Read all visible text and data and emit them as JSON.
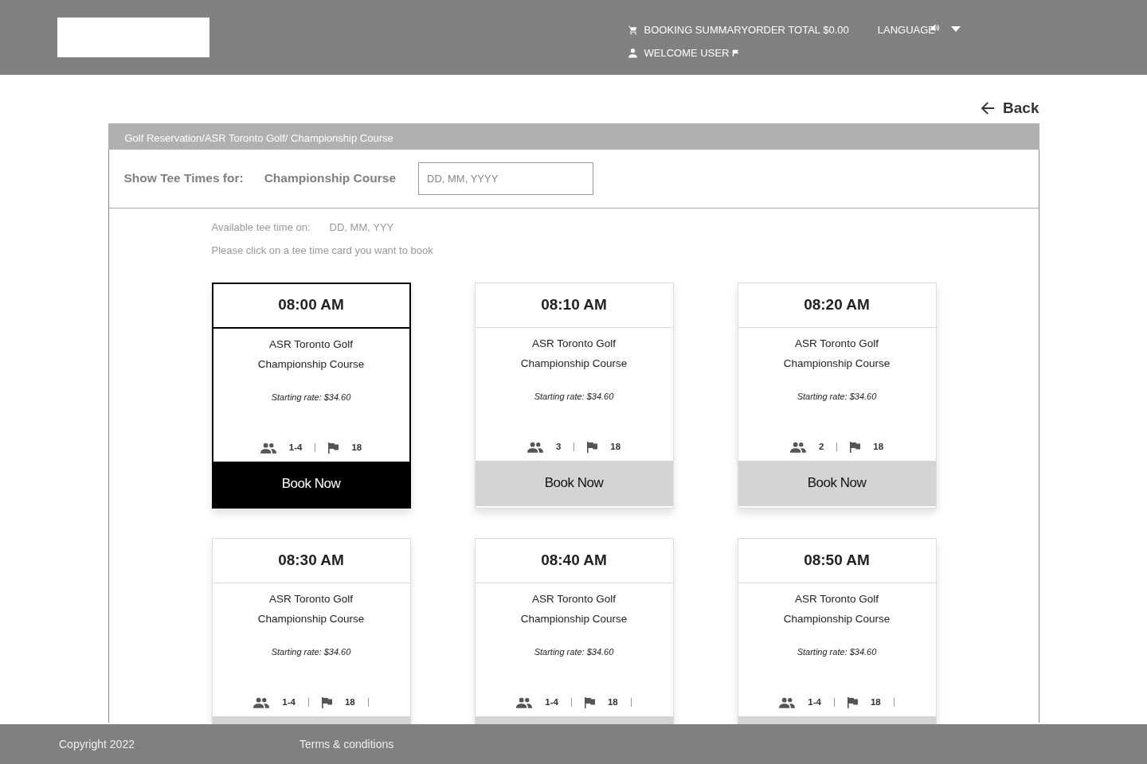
{
  "header": {
    "booking_summary": "BOOKING SUMMARYORDER TOTAL $0.00",
    "language": "LANGUAGE",
    "welcome": "WELCOME USER"
  },
  "back": "Back",
  "breadcrumb": "Golf Reservation/ASR Toronto Golf/ Championship Course",
  "filter": {
    "label": "Show Tee Times for:",
    "course": "Championship Course",
    "date_placeholder": "DD, MM, YYYY"
  },
  "available": {
    "label": "Available tee time on:",
    "date": "DD, MM, YYY"
  },
  "instruction": "Please click on a tee time card you want to book",
  "cards": [
    {
      "time": "08:00 AM",
      "club": "ASR Toronto Golf",
      "course": "Championship Course",
      "rate": "Starting rate: $34.60",
      "players": "1-4",
      "holes": "18",
      "selected": true,
      "trailing_divider": false,
      "button": "Book Now"
    },
    {
      "time": "08:10 AM",
      "club": "ASR Toronto Golf",
      "course": "Championship Course",
      "rate": "Starting rate: $34.60",
      "players": "3",
      "holes": "18",
      "selected": false,
      "trailing_divider": false,
      "button": "Book Now"
    },
    {
      "time": "08:20 AM",
      "club": "ASR Toronto Golf",
      "course": "Championship Course",
      "rate": "Starting rate: $34.60",
      "players": "2",
      "holes": "18",
      "selected": false,
      "trailing_divider": false,
      "button": "Book Now"
    },
    {
      "time": "08:30 AM",
      "club": "ASR Toronto Golf",
      "course": "Championship Course",
      "rate": "Starting rate: $34.60",
      "players": "1-4",
      "holes": "18",
      "selected": false,
      "trailing_divider": true
    },
    {
      "time": "08:40 AM",
      "club": "ASR Toronto Golf",
      "course": "Championship Course",
      "rate": "Starting rate: $34.60",
      "players": "1-4",
      "holes": "18",
      "selected": false,
      "trailing_divider": true
    },
    {
      "time": "08:50 AM",
      "club": "ASR Toronto Golf",
      "course": "Championship Course",
      "rate": "Starting rate: $34.60",
      "players": "1-4",
      "holes": "18",
      "selected": false,
      "trailing_divider": true
    }
  ],
  "footer": {
    "copyright": "Copyright 2022",
    "terms": "Terms & conditions"
  }
}
